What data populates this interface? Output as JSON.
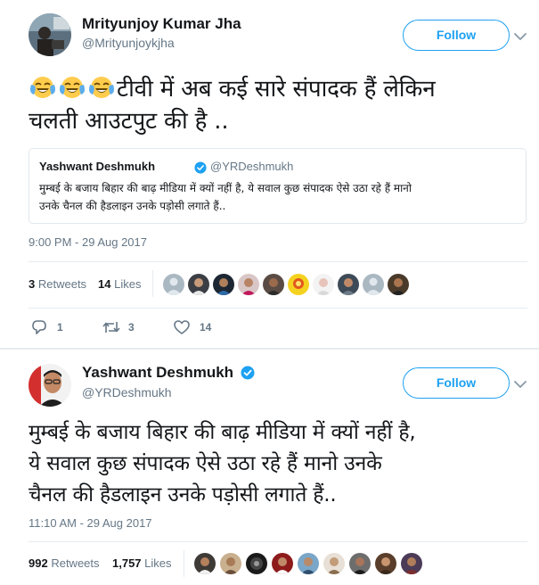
{
  "tweet1": {
    "display_name": "Mrityunjoy Kumar Jha",
    "handle": "@Mrityunjoykjha",
    "follow_label": "Follow",
    "text_line1": "टीवी में अब कई सारे संपादक हैं लेकिन",
    "text_line2": "चलती आउटपुट की है ..",
    "quote": {
      "display_name": "Yashwant Deshmukh",
      "handle": "@YRDeshmukh",
      "text_line1": "मुम्बई के बजाय बिहार की बाढ़ मीडिया में क्यों नहीं है, ये सवाल कुछ संपादक ऐसे उठा रहे हैं मानो",
      "text_line2": "उनके चैनल की हैडलाइन उनके पड़ोसी लगाते हैं.."
    },
    "timestamp": "9:00 PM - 29 Aug 2017",
    "retweets_count": "3",
    "retweets_label": "Retweets",
    "likes_count": "14",
    "likes_label": "Likes",
    "actions": {
      "reply_count": "1",
      "retweet_count": "3",
      "like_count": "14"
    }
  },
  "tweet2": {
    "display_name": "Yashwant Deshmukh",
    "handle": "@YRDeshmukh",
    "follow_label": "Follow",
    "text_line1": "मुम्बई के बजाय बिहार की बाढ़ मीडिया में क्यों नहीं है,",
    "text_line2": "ये सवाल कुछ संपादक ऐसे उठा रहे हैं मानो उनके",
    "text_line3": "चैनल की हैडलाइन उनके पड़ोसी लगाते हैं..",
    "timestamp": "11:10 AM - 29 Aug 2017",
    "retweets_count": "992",
    "retweets_label": "Retweets",
    "likes_count": "1,757",
    "likes_label": "Likes"
  },
  "colors": {
    "accent": "#1da1f2",
    "secondary_text": "#657786",
    "border": "#e1e8ed",
    "verified": "#1da1f2"
  },
  "icons": [
    "joy-emoji-icon",
    "verified-badge-icon",
    "chevron-down-icon",
    "reply-icon",
    "retweet-icon",
    "heart-icon"
  ]
}
